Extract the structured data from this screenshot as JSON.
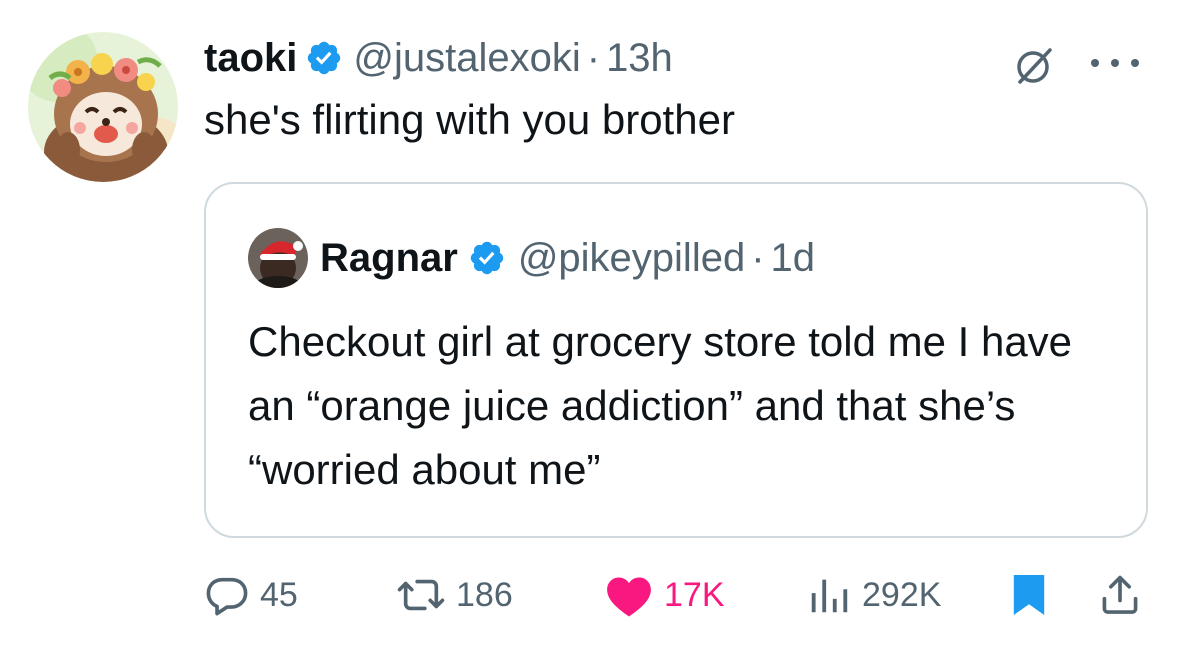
{
  "tweet": {
    "author_name": "taoki",
    "handle": "@justalexoki",
    "separator": "·",
    "time": "13h",
    "text": "she's flirting with you brother"
  },
  "quoted_tweet": {
    "author_name": "Ragnar",
    "handle": "@pikeypilled",
    "separator": "·",
    "time": "1d",
    "text": "Checkout girl at grocery store told me I have an “orange juice addiction” and that she’s “worried about me”"
  },
  "actions": {
    "replies": "45",
    "reposts": "186",
    "likes": "17K",
    "views": "292K"
  },
  "colors": {
    "verified": "#1d9bf0",
    "like": "#f91880",
    "bookmark": "#1d9bf0",
    "muted_text": "#536471"
  }
}
